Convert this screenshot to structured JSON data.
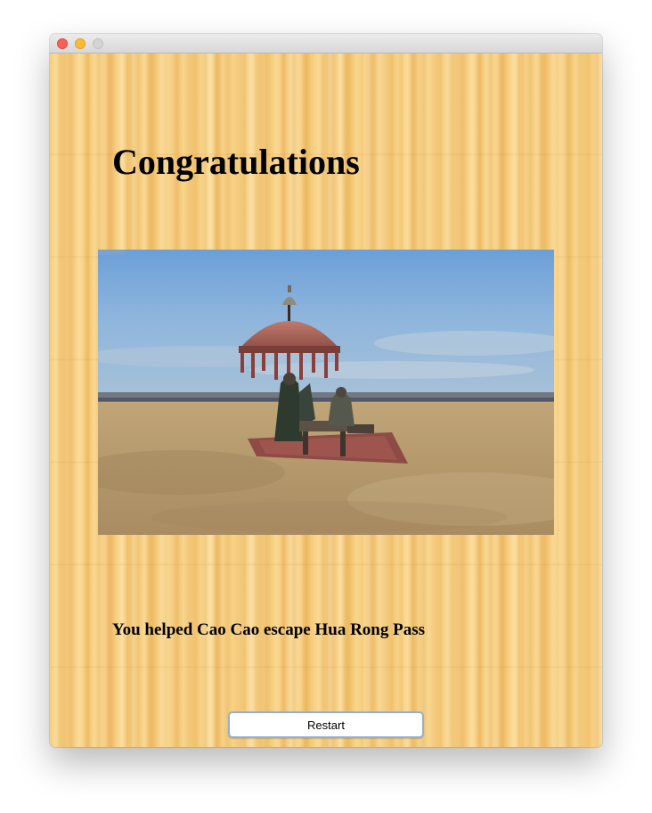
{
  "window": {
    "controls": [
      "close",
      "minimize",
      "maximize"
    ]
  },
  "main": {
    "title": "Congratulations",
    "message": "You helped Cao Cao escape Hua Rong Pass",
    "restart_label": "Restart"
  },
  "colors": {
    "wood_base": "#f5c977",
    "button_border": "#8fb0d0",
    "sky": "#7fa9d6",
    "sand": "#b89a6e"
  }
}
